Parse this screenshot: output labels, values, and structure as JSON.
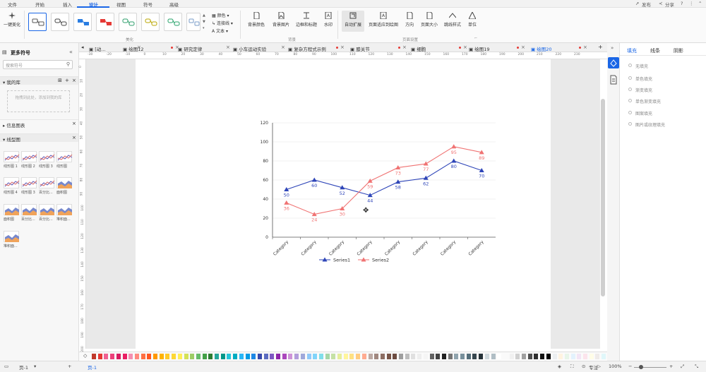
{
  "menu": {
    "items": [
      "文件",
      "开始",
      "插入",
      "设计",
      "视图",
      "符号",
      "高级"
    ],
    "active_index": 3,
    "right": [
      "发布",
      "分享"
    ]
  },
  "ribbon": {
    "one_click": "一键美化",
    "group_beautify": "美化",
    "style_items": [
      "颜色",
      "连接线",
      "文本"
    ],
    "bg_buttons": [
      "背景颜色",
      "背景图片",
      "边框和标题",
      "水印"
    ],
    "group_background": "背景",
    "page_buttons": [
      "自动扩展",
      "页面适应到绘图",
      "方向",
      "页面大小",
      "跳线样式",
      "单位"
    ],
    "group_page": "页面设置"
  },
  "left": {
    "title": "更多符号",
    "search_placeholder": "搜索符号",
    "my_library": "我的库",
    "drop_hint": "拖拽到此处，添加到我的库",
    "info_chart": "信息图表",
    "line_chart": "线型图",
    "thumbs": [
      "线形图 1",
      "线形图 2",
      "线形图 3",
      "线形图",
      "线形图 4",
      "线形图 3",
      "百分比...",
      "面积图",
      "面积图",
      "百分比...",
      "百分比...",
      "堆积面...",
      "堆积面..."
    ]
  },
  "tabs": [
    {
      "label": "[动...",
      "dot": false
    },
    {
      "label": "绘图12",
      "dot": true
    },
    {
      "label": "研究定律",
      "dot": false
    },
    {
      "label": "小车运动实验",
      "dot": false
    },
    {
      "label": "复杂方程式示例",
      "dot": true
    },
    {
      "label": "膝关节",
      "dot": true
    },
    {
      "label": "细胞",
      "dot": true
    },
    {
      "label": "绘图19",
      "dot": true
    },
    {
      "label": "绘图20",
      "dot": true,
      "active": true
    }
  ],
  "ruler": {
    "h": [
      "-30",
      "-20",
      "-10",
      "0",
      "10",
      "20",
      "30",
      "40",
      "50",
      "60",
      "70",
      "80",
      "90",
      "100",
      "110",
      "120",
      "130",
      "140",
      "150",
      "160",
      "170",
      "180",
      "190",
      "200",
      "210",
      "220",
      "230"
    ],
    "v": [
      "0",
      "10",
      "20",
      "30",
      "40",
      "50",
      "60",
      "70",
      "80",
      "90",
      "100",
      "110",
      "120",
      "130",
      "140",
      "150",
      "160",
      "170",
      "180",
      "190",
      "200"
    ]
  },
  "right": {
    "tabs": [
      "填充",
      "线条",
      "阴影"
    ],
    "options": [
      "无填充",
      "单色填充",
      "渐变填充",
      "单色渐变填充",
      "图案填充",
      "图片或纹理填充"
    ]
  },
  "status": {
    "page_left": "页-1",
    "page_tab": "页-1",
    "focus": "专注",
    "zoom": "100%"
  },
  "colors": {
    "accent": "#1a66e6",
    "series1": "#2e45b8",
    "series2": "#f07373"
  },
  "chart_data": {
    "type": "line",
    "categories": [
      "Category",
      "Category",
      "Category",
      "Category",
      "Category",
      "Category",
      "Category",
      "Category"
    ],
    "ylim": [
      0,
      120
    ],
    "yticks": [
      0,
      20,
      40,
      60,
      80,
      100,
      120
    ],
    "series": [
      {
        "name": "Series1",
        "values": [
          50,
          60,
          52,
          44,
          58,
          62,
          80,
          70
        ]
      },
      {
        "name": "Series2",
        "values": [
          36,
          24,
          30,
          59,
          73,
          77,
          95,
          89
        ]
      }
    ],
    "legend": "bottom"
  }
}
